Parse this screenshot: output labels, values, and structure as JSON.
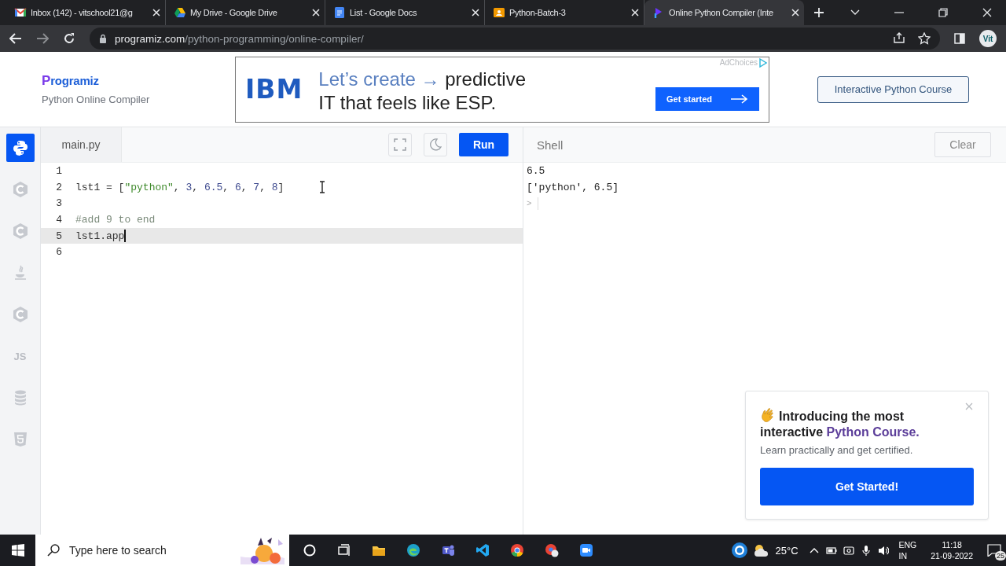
{
  "browser": {
    "tabs": [
      {
        "kind": "gmail",
        "title": "Inbox (142) - vitschool21@g",
        "selected": false
      },
      {
        "kind": "drive",
        "title": "My Drive - Google Drive",
        "selected": false
      },
      {
        "kind": "docs",
        "title": "List - Google Docs",
        "selected": false
      },
      {
        "kind": "slides",
        "title": "Python-Batch-3",
        "selected": false
      },
      {
        "kind": "programiz",
        "title": "Online Python Compiler (Inte",
        "selected": true
      }
    ],
    "address": {
      "host": "programiz.com",
      "path": "/python-programming/online-compiler/",
      "avatar": "Vit"
    }
  },
  "header": {
    "logo": "Programiz",
    "subtitle": "Python Online Compiler",
    "ad": {
      "brand": "IBM",
      "headline_lead": "Let’s create →",
      "headline_rest": "predictive",
      "headline_line_2": "IT that feels like ESP.",
      "button": "Get started",
      "badge": "AdChoices"
    },
    "course_button": "Interactive Python Course"
  },
  "sidebar": {
    "items": [
      {
        "kind": "python",
        "selected": true
      },
      {
        "kind": "c",
        "selected": false
      },
      {
        "kind": "c",
        "selected": false
      },
      {
        "kind": "java",
        "selected": false
      },
      {
        "kind": "c",
        "selected": false
      },
      {
        "kind": "text",
        "label": "JS",
        "selected": false
      },
      {
        "kind": "database",
        "selected": false
      },
      {
        "kind": "html",
        "selected": false
      }
    ]
  },
  "editor": {
    "file": "main.py",
    "run": "Run",
    "lines": [
      {
        "number": "1",
        "active": false
      },
      {
        "number": "2",
        "active": false,
        "tokens": [
          {
            "kind": "plain",
            "text": "lst1 = ["
          },
          {
            "kind": "string",
            "text": "\"python\""
          },
          {
            "kind": "plain",
            "text": ", "
          },
          {
            "kind": "number",
            "text": "3"
          },
          {
            "kind": "plain",
            "text": ", "
          },
          {
            "kind": "number",
            "text": "6.5"
          },
          {
            "kind": "plain",
            "text": ", "
          },
          {
            "kind": "number",
            "text": "6"
          },
          {
            "kind": "plain",
            "text": ", "
          },
          {
            "kind": "number",
            "text": "7"
          },
          {
            "kind": "plain",
            "text": ", "
          },
          {
            "kind": "number",
            "text": "8"
          },
          {
            "kind": "plain",
            "text": "]"
          }
        ]
      },
      {
        "number": "3",
        "active": false
      },
      {
        "number": "4",
        "active": false,
        "tokens": [
          {
            "kind": "comment",
            "text": "#add 9 to end"
          }
        ]
      },
      {
        "number": "5",
        "active": true,
        "tokens": [
          {
            "kind": "plain",
            "text": "lst1.app"
          }
        ]
      },
      {
        "number": "6",
        "active": false
      }
    ]
  },
  "shell": {
    "title": "Shell",
    "clear": "Clear",
    "output": [
      "6.5",
      "['python', 6.5]"
    ],
    "prompt": ">"
  },
  "popup": {
    "title_lead": "Introducing the most interactive",
    "title_highlight": "Python Course.",
    "subtitle": "Learn practically and get certified.",
    "button": "Get Started!"
  },
  "taskbar": {
    "search_placeholder": "Type here to search",
    "temperature": "25°C",
    "language": "ENG",
    "region": "IN",
    "time": "11:18",
    "date": "21-09-2022",
    "notifications": "25"
  }
}
